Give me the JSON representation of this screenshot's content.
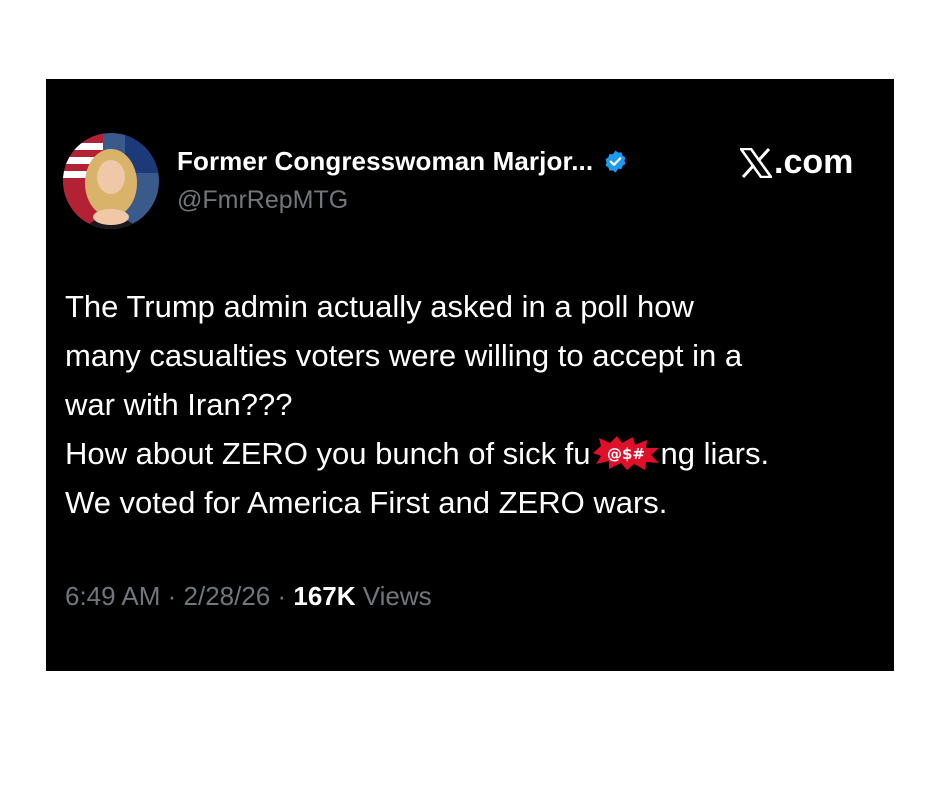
{
  "author": {
    "display_name": "Former Congresswoman Marjor...",
    "handle": "@FmrRepMTG"
  },
  "source": {
    "brand_label": ".com",
    "brand_icon": "x-logo-icon"
  },
  "tweet": {
    "lines": [
      "The Trump admin actually asked in a poll how",
      "many casualties voters were willing to accept in a",
      "war with Iran???"
    ],
    "line4_prefix": "How about ZERO you bunch of sick fu",
    "censor_symbols": "@$#",
    "line4_suffix": "ng liars.",
    "line5": "We voted for America First and ZERO wars."
  },
  "meta": {
    "time": "6:49 AM",
    "separator": " · ",
    "date": "2/28/26",
    "views_count": "167K",
    "views_label": " Views"
  },
  "colors": {
    "background": "#000000",
    "text": "#ffffff",
    "muted": "#71767b",
    "verified": "#1d9bf0",
    "censor_burst": "#e0102a"
  }
}
